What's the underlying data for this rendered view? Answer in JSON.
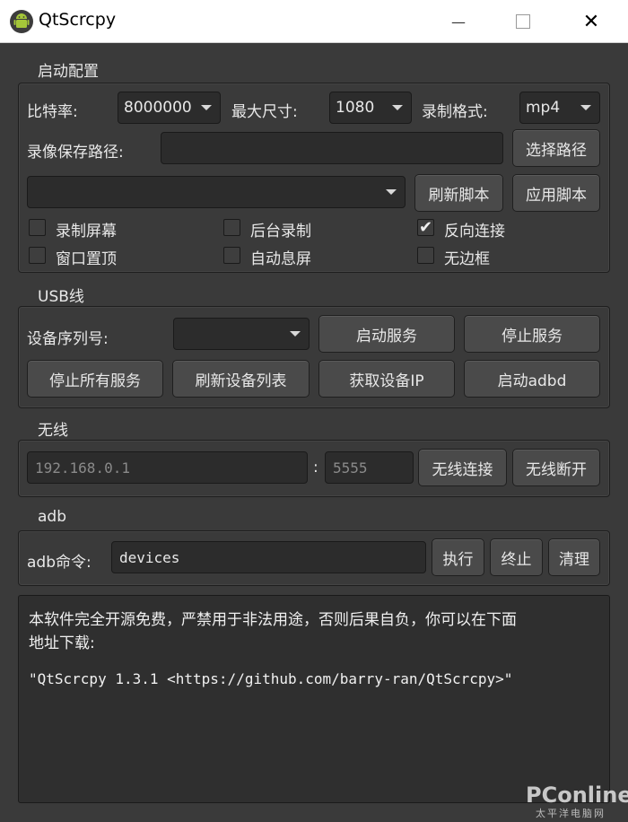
{
  "window": {
    "title": "QtScrcpy",
    "app_icon": "android-icon",
    "minimize_glyph": "—",
    "maximize_glyph": "☐",
    "close_glyph": "✕"
  },
  "launch": {
    "title": "启动配置",
    "bitrate_label": "比特率:",
    "bitrate_value": "8000000",
    "max_size_label": "最大尺寸:",
    "max_size_value": "1080",
    "record_format_label": "录制格式:",
    "record_format_value": "mp4",
    "save_path_label": "录像保存路径:",
    "save_path_value": "",
    "select_path_button": "选择路径",
    "script_value": "",
    "refresh_script_button": "刷新脚本",
    "apply_script_button": "应用脚本",
    "checkboxes": [
      {
        "label": "录制屏幕",
        "checked": false
      },
      {
        "label": "后台录制",
        "checked": false
      },
      {
        "label": "反向连接",
        "checked": true
      },
      {
        "label": "窗口置顶",
        "checked": false
      },
      {
        "label": "自动息屏",
        "checked": false
      },
      {
        "label": "无边框",
        "checked": false
      }
    ]
  },
  "usb": {
    "title": "USB线",
    "serial_label": "设备序列号:",
    "serial_value": "",
    "start_server_button": "启动服务",
    "stop_server_button": "停止服务",
    "stop_all_button": "停止所有服务",
    "refresh_devices_button": "刷新设备列表",
    "get_ip_button": "获取设备IP",
    "start_adbd_button": "启动adbd"
  },
  "wireless": {
    "title": "无线",
    "ip_placeholder": "192.168.0.1",
    "separator": ":",
    "port_placeholder": "5555",
    "connect_button": "无线连接",
    "disconnect_button": "无线断开"
  },
  "adb": {
    "title": "adb",
    "command_label": "adb命令:",
    "command_value": "devices",
    "execute_button": "执行",
    "stop_button": "终止",
    "clear_button": "清理"
  },
  "output": {
    "line1": "本软件完全开源免费，严禁用于非法用途，否则后果自负，你可以在下面",
    "line2": "地址下载:",
    "line3": "\"QtScrcpy 1.3.1 <https://github.com/barry-ran/QtScrcpy>\""
  },
  "watermark": {
    "brand": "PConline",
    "sub": "太平洋电脑网"
  }
}
